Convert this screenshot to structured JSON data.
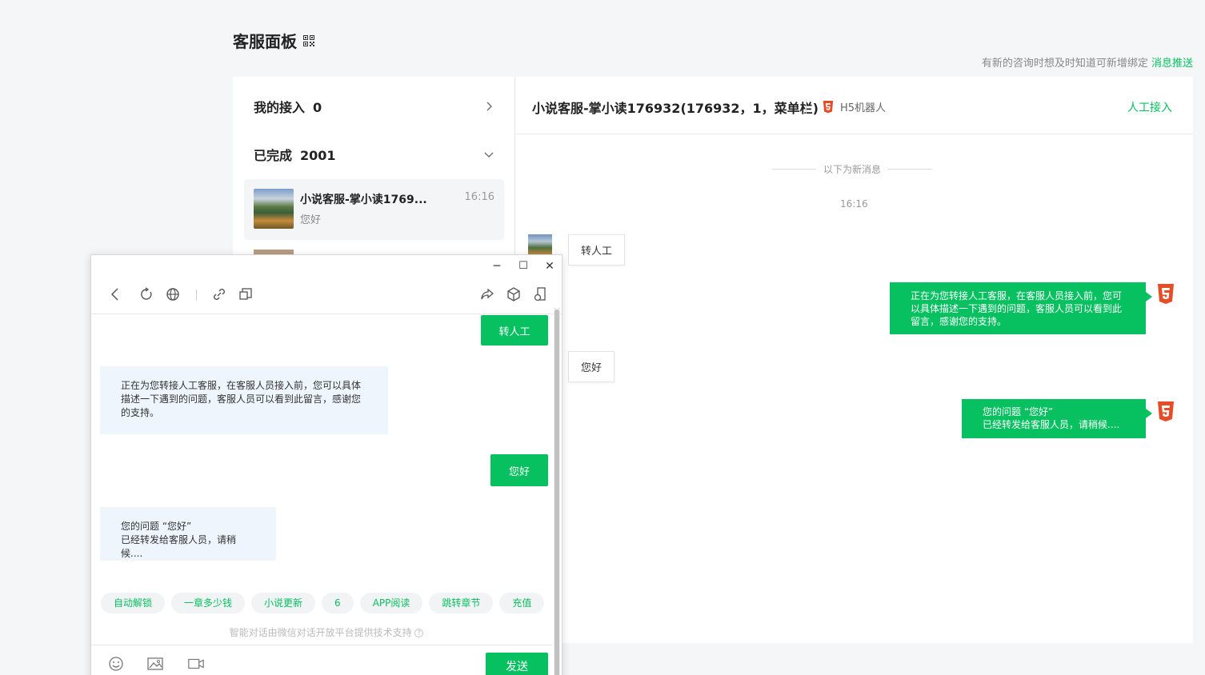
{
  "page": {
    "title": "客服面板",
    "hint_text": "有新的咨询时想及时知道可新增绑定",
    "hint_link": "消息推送"
  },
  "left": {
    "my_access_label": "我的接入",
    "my_access_count": "0",
    "completed_label": "已完成",
    "completed_count": "2001",
    "conversation": {
      "name": "小说客服-掌小读1769...",
      "time": "16:16",
      "preview": "您好"
    }
  },
  "chat": {
    "title": "小说客服-掌小读176932(176932，1，菜单栏)",
    "robot_label": "H5机器人",
    "manual_link": "人工接入",
    "divider": "以下为新消息",
    "time": "16:16",
    "messages": [
      {
        "from": "user",
        "text": "转人工"
      },
      {
        "from": "bot",
        "text": "正在为您转接人工客服，在客服人员接入前，您可以具体描述一下遇到的问题，客服人员可以看到此留言，感谢您的支持。"
      },
      {
        "from": "user",
        "text": "您好"
      },
      {
        "from": "bot",
        "text": "您的问题 “您好”\n已经转发给客服人员，请稍候...."
      }
    ]
  },
  "mini": {
    "messages": [
      {
        "from": "user",
        "text": "转人工"
      },
      {
        "from": "bot",
        "text": "正在为您转接人工客服，在客服人员接入前，您可以具体描述一下遇到的问题，客服人员可以看到此留言，感谢您的支持。"
      },
      {
        "from": "user",
        "text": "您好"
      },
      {
        "from": "bot",
        "text": "您的问题 “您好”\n已经转发给客服人员，请稍候...."
      }
    ],
    "chips": [
      "自动解锁",
      "一章多少钱",
      "小说更新",
      "6",
      "APP阅读",
      "跳转章节",
      "充值"
    ],
    "powered_by": "智能对话由微信对话开放平台提供技术支持",
    "send_label": "发送"
  },
  "colors": {
    "accent": "#07c160",
    "h5": "#e44d26"
  }
}
